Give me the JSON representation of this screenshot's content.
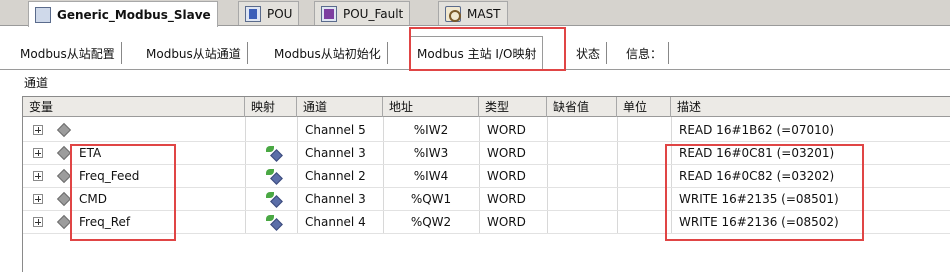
{
  "doc_tabs": [
    {
      "label": "Generic_Modbus_Slave",
      "icon": "slave-device-icon"
    },
    {
      "label": "POU",
      "icon": "pou-icon"
    },
    {
      "label": "POU_Fault",
      "icon": "pou-fault-icon"
    },
    {
      "label": "MAST",
      "icon": "mast-task-icon"
    }
  ],
  "config_tabs": [
    {
      "label": "Modbus从站配置"
    },
    {
      "label": "Modbus从站通道"
    },
    {
      "label": "Modbus从站初始化"
    },
    {
      "label": "Modbus 主站 I/O映射"
    },
    {
      "label": "状态"
    },
    {
      "label": "信息："
    }
  ],
  "section_label": "通道",
  "table": {
    "columns": [
      "变量",
      "映射",
      "通道",
      "地址",
      "类型",
      "缺省值",
      "单位",
      "描述"
    ],
    "rows": [
      {
        "variable": "",
        "mapped": false,
        "channel": "Channel 5",
        "address": "%IW2",
        "type": "WORD",
        "default": "",
        "unit": "",
        "description": "READ  16#1B62 (=07010)"
      },
      {
        "variable": "ETA",
        "mapped": true,
        "channel": "Channel 3",
        "address": "%IW3",
        "type": "WORD",
        "default": "",
        "unit": "",
        "description": "READ  16#0C81 (=03201)"
      },
      {
        "variable": "Freq_Feed",
        "mapped": true,
        "channel": "Channel 2",
        "address": "%IW4",
        "type": "WORD",
        "default": "",
        "unit": "",
        "description": "READ  16#0C82 (=03202)"
      },
      {
        "variable": "CMD",
        "mapped": true,
        "channel": "Channel 3",
        "address": "%QW1",
        "type": "WORD",
        "default": "",
        "unit": "",
        "description": "WRITE 16#2135 (=08501)"
      },
      {
        "variable": "Freq_Ref",
        "mapped": true,
        "channel": "Channel 4",
        "address": "%QW2",
        "type": "WORD",
        "default": "",
        "unit": "",
        "description": "WRITE 16#2136 (=08502)"
      }
    ]
  },
  "colors": {
    "highlight": "#e04545",
    "tab_strip": "#d6d3ce"
  }
}
